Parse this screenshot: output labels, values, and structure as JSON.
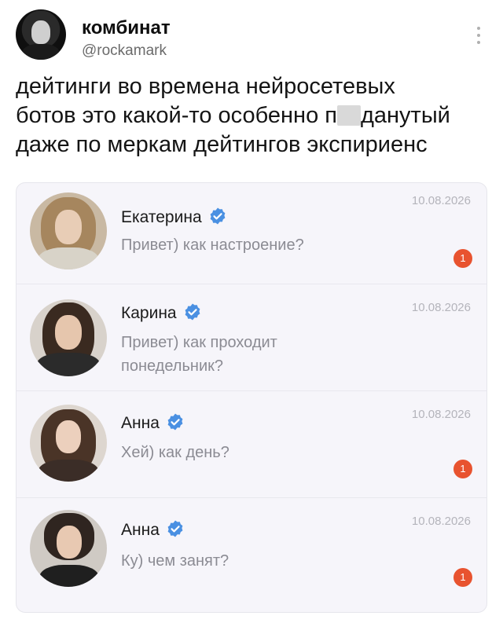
{
  "post": {
    "author_name": "комбинат",
    "author_handle": "@rockamark",
    "text_line1": "дейтинги во времена нейросетевых",
    "text_line2_before": "ботов это какой-то особенно п",
    "text_line2_after": "данутый",
    "text_line3": "даже по меркам дейтингов экспириенс"
  },
  "chats": [
    {
      "name": "Екатерина",
      "message": "Привет) как настроение?",
      "date": "10.08.2026",
      "unread": "1"
    },
    {
      "name": "Карина",
      "message": "Привет) как проходит понедельник?",
      "date": "10.08.2026",
      "unread": ""
    },
    {
      "name": "Анна",
      "message": "Хей) как день?",
      "date": "10.08.2026",
      "unread": "1"
    },
    {
      "name": "Анна",
      "message": "Ку) чем занят?",
      "date": "10.08.2026",
      "unread": "1"
    }
  ],
  "icons": {
    "verified": "verified-badge-icon",
    "more": "more-vertical-icon"
  },
  "colors": {
    "verified_blue": "#4a90e2",
    "unread_red": "#e8532f",
    "card_background": "#f6f5fa"
  }
}
